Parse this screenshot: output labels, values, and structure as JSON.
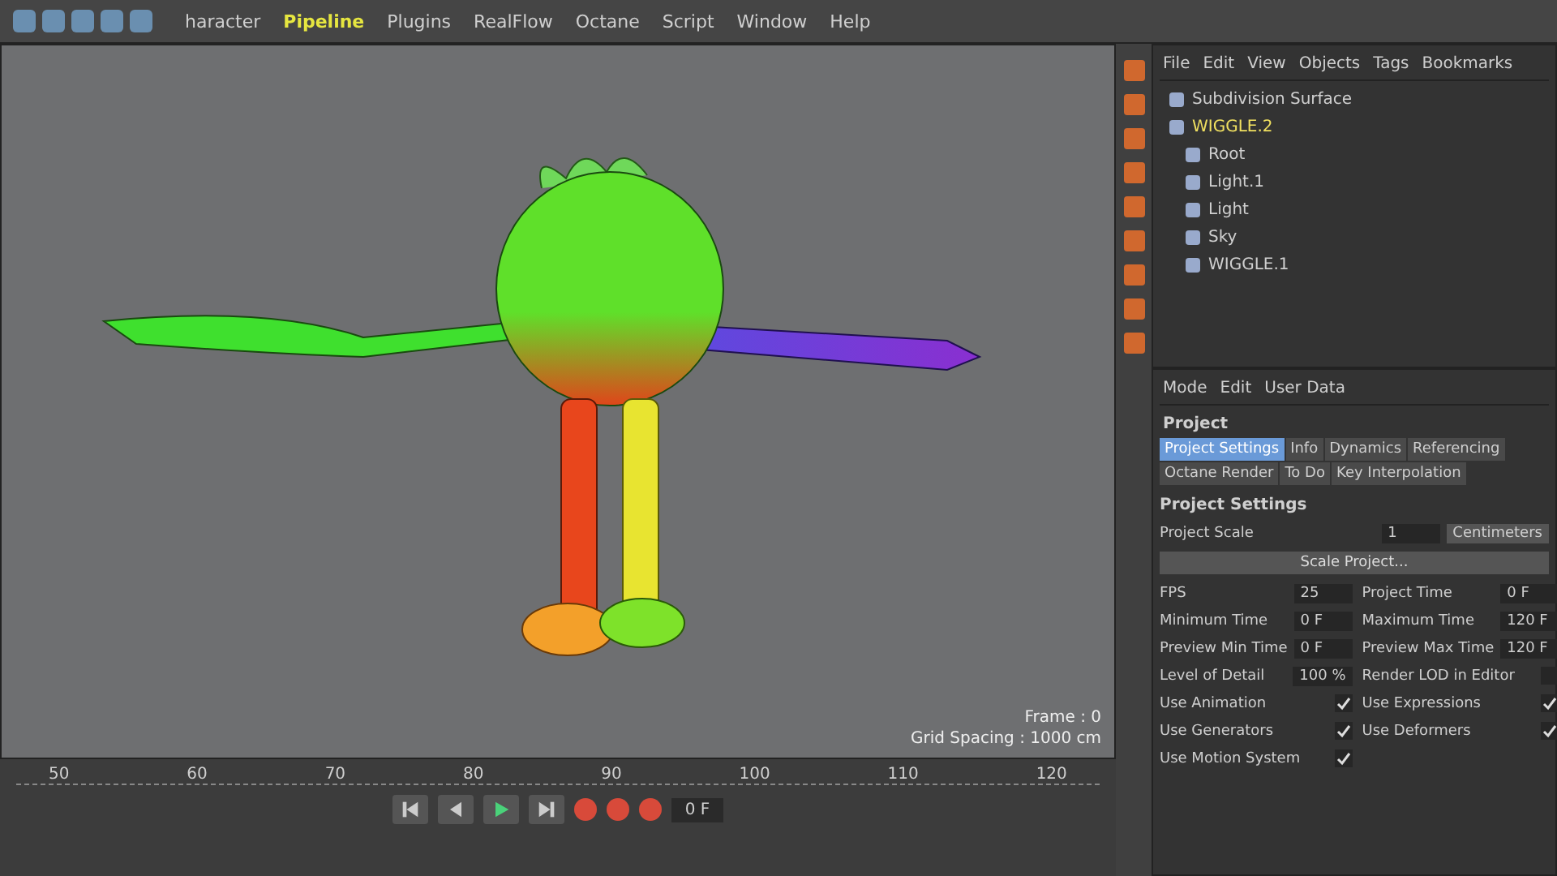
{
  "menu": [
    {
      "label": "haracter",
      "selected": false
    },
    {
      "label": "Pipeline",
      "selected": true
    },
    {
      "label": "Plugins",
      "selected": false
    },
    {
      "label": "RealFlow",
      "selected": false
    },
    {
      "label": "Octane",
      "selected": false
    },
    {
      "label": "Script",
      "selected": false
    },
    {
      "label": "Window",
      "selected": false
    },
    {
      "label": "Help",
      "selected": false
    }
  ],
  "viewport": {
    "frame": "Frame : 0",
    "grid_spacing": "Grid Spacing : 1000 cm"
  },
  "object_manager": {
    "menu": [
      "File",
      "Edit",
      "View",
      "Objects",
      "Tags",
      "Bookmarks"
    ],
    "objects": [
      {
        "name": "Subdivision Surface",
        "selected": false
      },
      {
        "name": "WIGGLE.2",
        "selected": true,
        "children": [
          {
            "name": "Root",
            "selected": false
          },
          {
            "name": "Light.1",
            "selected": false
          },
          {
            "name": "Light",
            "selected": false
          },
          {
            "name": "Sky",
            "selected": false
          },
          {
            "name": "WIGGLE.1",
            "selected": false
          }
        ]
      }
    ]
  },
  "attribute_manager": {
    "menu": [
      "Mode",
      "Edit",
      "User Data"
    ],
    "title": "Project",
    "tabs": [
      {
        "label": "Project Settings",
        "selected": true
      },
      {
        "label": "Info",
        "selected": false
      },
      {
        "label": "Dynamics",
        "selected": false
      },
      {
        "label": "Referencing",
        "selected": false
      },
      {
        "label": "Octane Render",
        "selected": false
      },
      {
        "label": "To Do",
        "selected": false
      },
      {
        "label": "Key Interpolation",
        "selected": false
      }
    ],
    "section": "Project Settings",
    "scale": {
      "label": "Project Scale",
      "value": "1",
      "unit": "Centimeters"
    },
    "scale_button": "Scale Project...",
    "left_fields": [
      {
        "label": "FPS",
        "value": "25"
      },
      {
        "label": "Minimum Time",
        "value": "0 F"
      },
      {
        "label": "Preview Min Time",
        "value": "0 F"
      },
      {
        "label": "Level of Detail",
        "value": "100 %"
      }
    ],
    "right_fields": [
      {
        "label": "Project Time",
        "value": "0 F"
      },
      {
        "label": "Maximum Time",
        "value": "120 F"
      },
      {
        "label": "Preview Max Time",
        "value": "120 F"
      }
    ],
    "left_checks": [
      {
        "label": "Use Animation",
        "checked": true
      },
      {
        "label": "Use Generators",
        "checked": true
      },
      {
        "label": "Use Motion System",
        "checked": true
      }
    ],
    "right_checks": [
      {
        "label": "Render LOD in Editor",
        "checked": false
      },
      {
        "label": "Use Expressions",
        "checked": true
      },
      {
        "label": "Use Deformers",
        "checked": true
      }
    ]
  },
  "timeline": {
    "ticks": [
      "50",
      "60",
      "70",
      "80",
      "90",
      "100",
      "110",
      "120"
    ],
    "current": "0 F"
  }
}
